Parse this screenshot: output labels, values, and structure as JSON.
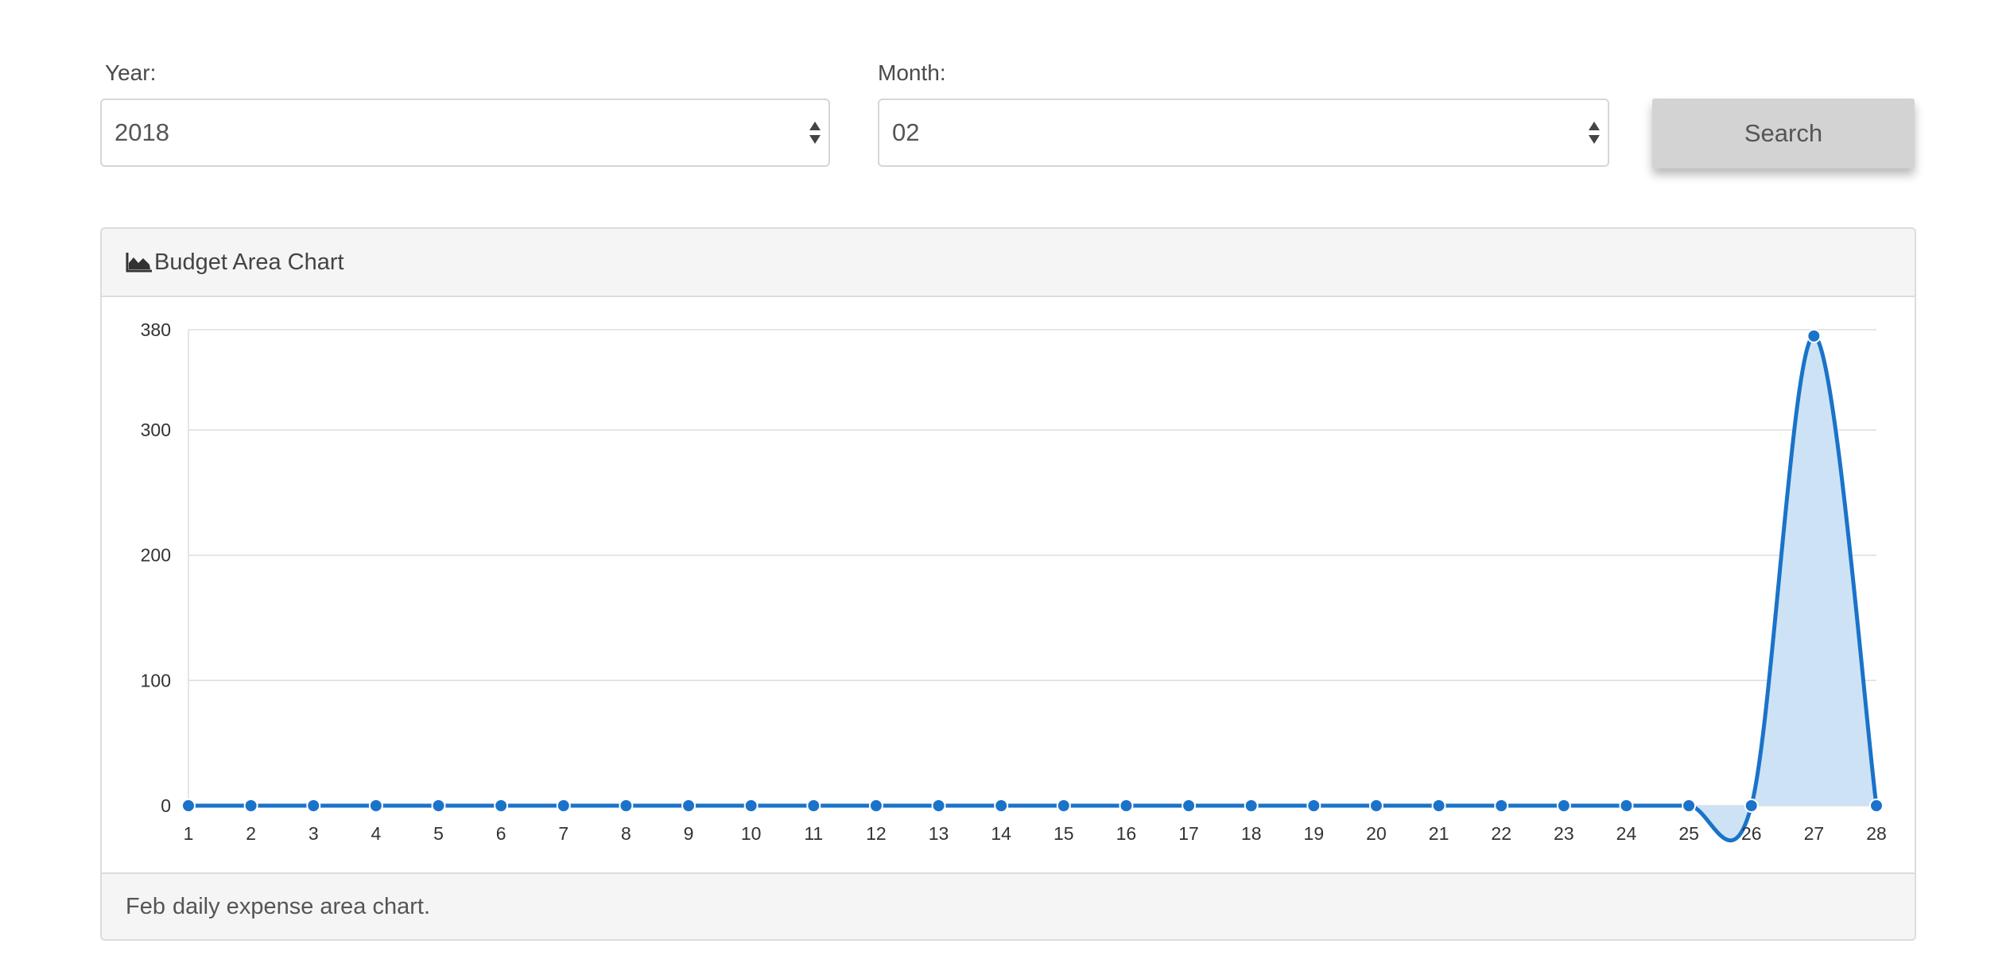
{
  "filters": {
    "year_label": "Year:",
    "year_value": "2018",
    "month_label": "Month:",
    "month_value": "02",
    "search_label": "Search"
  },
  "panel": {
    "heading": "Budget Area Chart",
    "footer_month": "Feb",
    "footer_text": "daily expense area chart."
  },
  "colors": {
    "line": "#1a73c9",
    "fill": "#cde3f5",
    "grid": "#dddddd"
  },
  "chart_data": {
    "type": "area",
    "categories": [
      "1",
      "2",
      "3",
      "4",
      "5",
      "6",
      "7",
      "8",
      "9",
      "10",
      "11",
      "12",
      "13",
      "14",
      "15",
      "16",
      "17",
      "18",
      "19",
      "20",
      "21",
      "22",
      "23",
      "24",
      "25",
      "26",
      "27",
      "28"
    ],
    "values": [
      0,
      0,
      0,
      0,
      0,
      0,
      0,
      0,
      0,
      0,
      0,
      0,
      0,
      0,
      0,
      0,
      0,
      0,
      0,
      0,
      0,
      0,
      0,
      0,
      0,
      0,
      375,
      0
    ],
    "y_ticks": [
      0,
      100,
      200,
      300,
      380
    ],
    "ylim": [
      0,
      380
    ],
    "grid": true,
    "legend": "none"
  }
}
